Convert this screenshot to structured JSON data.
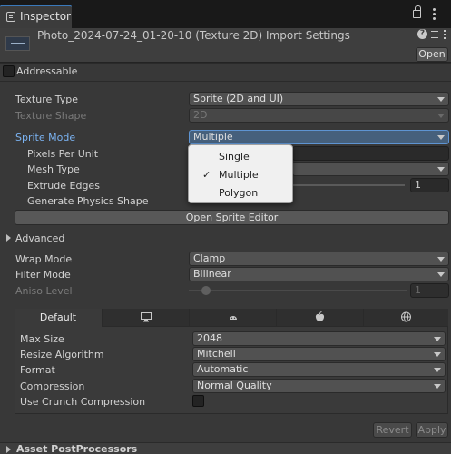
{
  "tab": {
    "title": "Inspector",
    "icon": "inspector-icon"
  },
  "header": {
    "title": "Photo_2024-07-24_01-20-10 (Texture 2D) Import Settings",
    "help_glyph": "?",
    "open_label": "Open"
  },
  "addressable": {
    "label": "Addressable",
    "checked": false
  },
  "properties": {
    "texture_type": {
      "label": "Texture Type",
      "value": "Sprite (2D and UI)"
    },
    "texture_shape": {
      "label": "Texture Shape",
      "value": "2D"
    },
    "sprite_mode": {
      "label": "Sprite Mode",
      "value": "Multiple"
    },
    "pixels_per_unit": {
      "label": "Pixels Per Unit"
    },
    "mesh_type": {
      "label": "Mesh Type"
    },
    "extrude_edges": {
      "label": "Extrude Edges",
      "value": "1"
    },
    "generate_physics_shape": {
      "label": "Generate Physics Shape"
    },
    "open_sprite_editor": "Open Sprite Editor"
  },
  "advanced": {
    "label": "Advanced"
  },
  "wrap_mode": {
    "label": "Wrap Mode",
    "value": "Clamp"
  },
  "filter_mode": {
    "label": "Filter Mode",
    "value": "Bilinear"
  },
  "aniso_level": {
    "label": "Aniso Level",
    "value": "1"
  },
  "platform": {
    "tabs": [
      {
        "label": "Default",
        "icon": ""
      },
      {
        "label": "",
        "icon": "monitor-icon"
      },
      {
        "label": "",
        "icon": "android-icon"
      },
      {
        "label": "",
        "icon": "apple-icon"
      },
      {
        "label": "",
        "icon": "webgl-icon"
      }
    ],
    "max_size": {
      "label": "Max Size",
      "value": "2048"
    },
    "resize_algorithm": {
      "label": "Resize Algorithm",
      "value": "Mitchell"
    },
    "format": {
      "label": "Format",
      "value": "Automatic"
    },
    "compression": {
      "label": "Compression",
      "value": "Normal Quality"
    },
    "use_crunch": {
      "label": "Use Crunch Compression",
      "checked": false
    }
  },
  "actions": {
    "revert": "Revert",
    "apply": "Apply"
  },
  "footer": {
    "label": "Asset PostProcessors"
  },
  "sprite_mode_popup": {
    "items": [
      {
        "label": "Single",
        "checked": false
      },
      {
        "label": "Multiple",
        "checked": true
      },
      {
        "label": "Polygon",
        "checked": false
      }
    ],
    "check_glyph": "✓"
  },
  "colors": {
    "accent": "#3a79bb",
    "label_highlight": "#7bb3f2",
    "background": "#383838"
  }
}
